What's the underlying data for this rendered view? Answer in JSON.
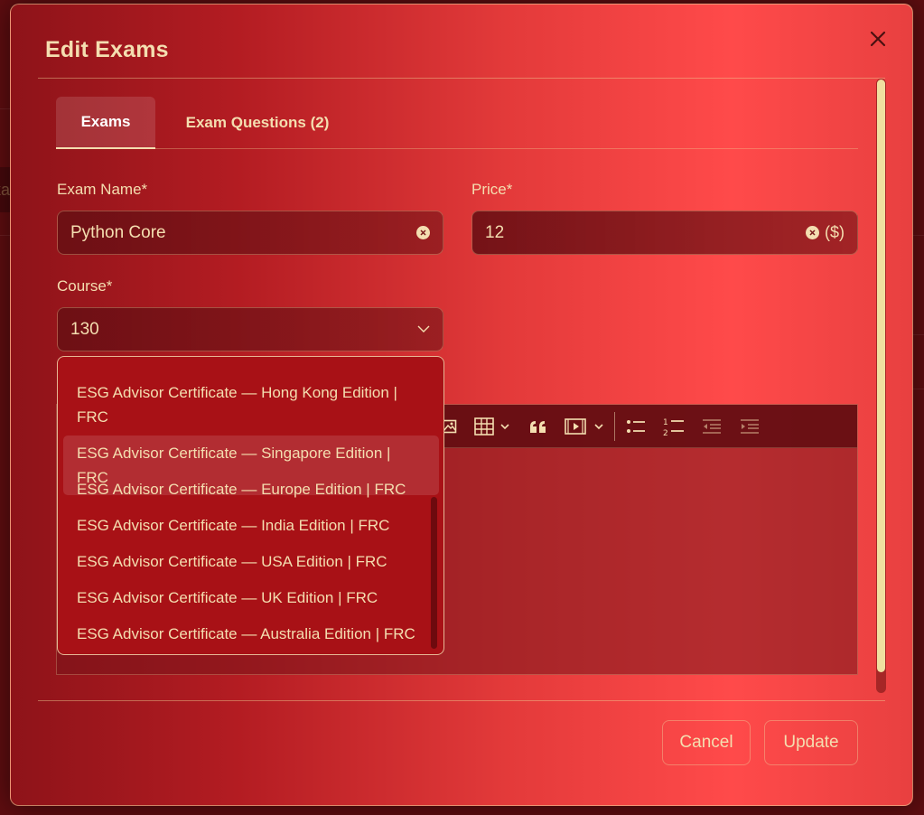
{
  "background": {
    "text_fragment": "ka"
  },
  "modal": {
    "title": "Edit Exams"
  },
  "tabs": [
    {
      "label": "Exams",
      "active": true
    },
    {
      "label": "Exam Questions (2)",
      "active": false
    }
  ],
  "form": {
    "exam_name": {
      "label": "Exam Name*",
      "value": "Python Core"
    },
    "price": {
      "label": "Price*",
      "value": "12",
      "suffix": "($)"
    },
    "course": {
      "label": "Course*",
      "value": "130"
    }
  },
  "course_dropdown": {
    "options": [
      "ESG Advisor Certificate — Hong Kong Edition | FRC",
      "ESG Advisor Certificate — Singapore Edition | FRC",
      "ESG Advisor Certificate — Europe Edition | FRC",
      "ESG Advisor Certificate — India Edition | FRC",
      "ESG Advisor Certificate — USA Edition | FRC",
      "ESG Advisor Certificate — UK Edition | FRC",
      "ESG Advisor Certificate — Australia Edition | FRC"
    ],
    "highlighted_option": "ESG Advisor Certificate — Singapore Edition | FRC"
  },
  "editor_toolbar": {
    "icons": [
      "image-icon",
      "table-icon",
      "blockquote-icon",
      "media-embed-icon",
      "bulleted-list-icon",
      "numbered-list-icon",
      "outdent-icon",
      "indent-icon"
    ]
  },
  "footer": {
    "cancel_label": "Cancel",
    "update_label": "Update"
  },
  "colors": {
    "accent_text": "#f4deb0",
    "dropdown_bg": "#a81116",
    "modal_gradient_start": "#8e1319",
    "modal_gradient_end": "#ff4a4a"
  }
}
